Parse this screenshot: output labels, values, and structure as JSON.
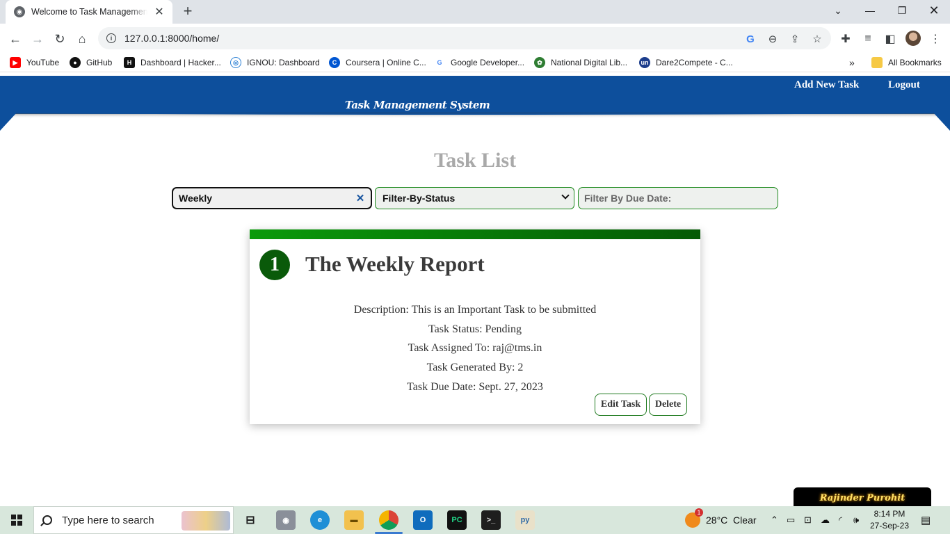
{
  "browser": {
    "tab_title": "Welcome to Task Management S",
    "url": "127.0.0.1:8000/home/",
    "bookmarks": [
      {
        "label": "YouTube",
        "icon": "youtube-icon",
        "color": "#ff0000"
      },
      {
        "label": "GitHub",
        "icon": "github-icon",
        "color": "#111111"
      },
      {
        "label": "Dashboard | Hacker...",
        "icon": "hackerrank-icon",
        "color": "#111111"
      },
      {
        "label": "IGNOU: Dashboard",
        "icon": "ignou-icon",
        "color": "#2a7fd4"
      },
      {
        "label": "Coursera | Online C...",
        "icon": "coursera-icon",
        "color": "#0056d2"
      },
      {
        "label": "Google Developer...",
        "icon": "google-icon",
        "color": "#4285f4"
      },
      {
        "label": "National Digital Lib...",
        "icon": "ndl-icon",
        "color": "#2e7d32"
      },
      {
        "label": "Dare2Compete - C...",
        "icon": "dare2compete-icon",
        "color": "#1c3d8c"
      }
    ],
    "all_bookmarks": "All Bookmarks"
  },
  "header": {
    "add_task": "Add New Task",
    "logout": "Logout",
    "site_title": "Task Management System",
    "color": "#0d4f9c"
  },
  "main": {
    "title": "Task List",
    "search_value": "Weekly",
    "status_filter": "Filter-By-Status",
    "due_date_placeholder": "Filter By Due Date:"
  },
  "task": {
    "number": "1",
    "title": "The Weekly Report",
    "description": "Description: This is an Important Task to be submitted",
    "status": "Task Status: Pending",
    "assigned_to": "Task Assigned To: raj@tms.in",
    "generated_by": "Task Generated By: 2",
    "due_date": "Task Due Date: Sept. 27, 2023",
    "edit_label": "Edit Task",
    "delete_label": "Delete"
  },
  "name_tag": "Rajinder Purohit",
  "taskbar": {
    "search_placeholder": "Type here to search",
    "weather_badge": "1",
    "weather": "28°C  Clear",
    "time": "8:14 PM",
    "date": "27-Sep-23"
  }
}
